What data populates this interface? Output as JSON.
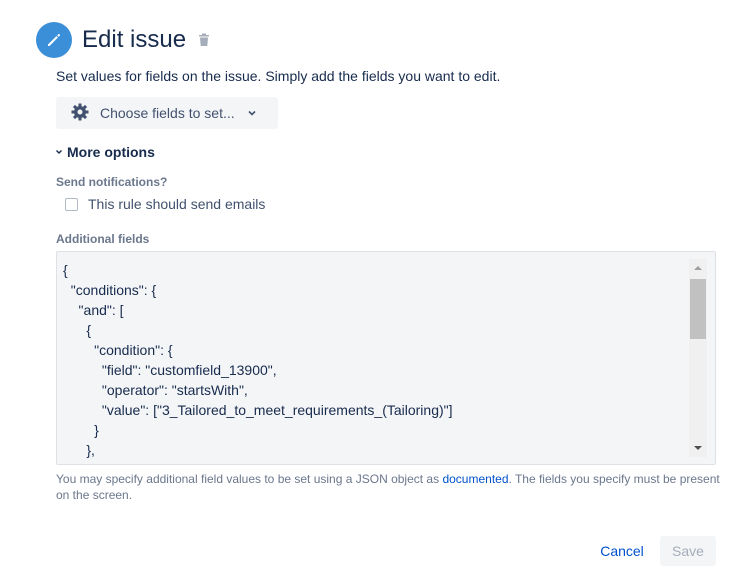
{
  "header": {
    "title": "Edit issue"
  },
  "description": "Set values for fields on the issue. Simply add the fields you want to edit.",
  "choose_fields": {
    "label": "Choose fields to set..."
  },
  "more_options": {
    "label": "More options"
  },
  "notifications": {
    "label": "Send notifications?",
    "checkbox_label": "This rule should send emails",
    "checked": false
  },
  "additional_fields": {
    "label": "Additional fields",
    "value": "{\n  \"conditions\": {\n    \"and\": [\n      {\n        \"condition\": {\n          \"field\": \"customfield_13900\",\n          \"operator\": \"startsWith\",\n          \"value\": [\"3_Tailored_to_meet_requirements_(Tailoring)\"]\n        }\n      },",
    "help_before": "You may specify additional field values to be set using a JSON object as ",
    "help_link": "documented",
    "help_after": ". The fields you specify must be present on the screen."
  },
  "footer": {
    "cancel_label": "Cancel",
    "save_label": "Save"
  },
  "colors": {
    "accent": "#0052cc",
    "icon_bg": "#3b8fd8"
  }
}
